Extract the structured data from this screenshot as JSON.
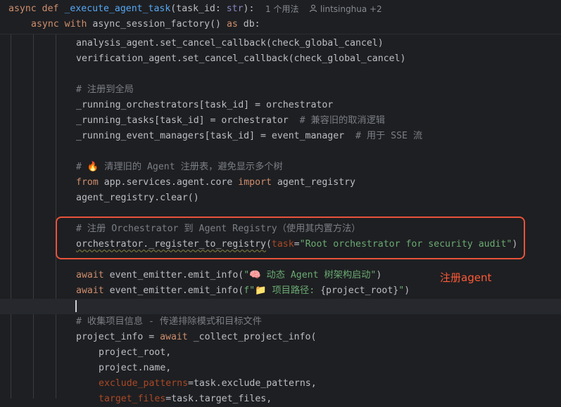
{
  "header": {
    "kw_async": "async",
    "kw_def": "def",
    "func_name": "_execute_agent_task",
    "sig_open": "(",
    "param_name": "task_id",
    "sig_colon": ": ",
    "param_type": "str",
    "sig_close": "):",
    "usage_hint": "1 个用法",
    "author_hint": "lintsinghua +2",
    "line2_kw_async": "async",
    "line2_kw_with": "with",
    "line2_call": "async_session_factory()",
    "line2_kw_as": "as",
    "line2_rest": "db:"
  },
  "code": {
    "l3": "analysis_agent.set_cancel_callback(check_global_cancel)",
    "l4": "verification_agent.set_cancel_callback(check_global_cancel)",
    "l6_comment": "# 注册到全局",
    "l7": "_running_orchestrators[task_id] = orchestrator",
    "l8_code": "_running_tasks[task_id] = orchestrator  ",
    "l8_comment": "# 兼容旧的取消逻辑",
    "l9_code": "_running_event_managers[task_id] = event_manager  ",
    "l9_comment": "# 用于 SSE 流",
    "l11_comment_a": "# ",
    "l11_emoji": "🔥",
    "l11_comment_b": " 清理旧的 Agent 注册表，避免显示多个树",
    "l12_from": "from",
    "l12_mod": " app.services.agent.core ",
    "l12_import": "import",
    "l12_name": " agent_registry",
    "l13": "agent_registry.clear()",
    "l15_comment": "# 注册 Orchestrator 到 Agent Registry（使用其内置方法）",
    "l16_call": "orchestrator._register_to_registry",
    "l16_open": "(",
    "l16_kwarg": "task",
    "l16_eq": "=",
    "l16_str": "\"Root orchestrator for security audit\"",
    "l16_close": ")",
    "l18_await": "await",
    "l18_call": " event_emitter.emit_info(",
    "l18_str_a": "\"",
    "l18_emoji": "🧠",
    "l18_str_b": " 动态 Agent 树架构启动\"",
    "l18_close": ")",
    "l19_await": "await",
    "l19_call": " event_emitter.emit_info(",
    "l19_str_a": "f\"",
    "l19_emoji": "📁",
    "l19_str_b": " 项目路径: ",
    "l19_interp": "{project_root}",
    "l19_str_c": "\"",
    "l19_close": ")",
    "l21_comment": "# 收集项目信息 - 传递排除模式和目标文件",
    "l22_code": "project_info = ",
    "l22_await": "await",
    "l22_rest": " _collect_project_info(",
    "l23": "project_root,",
    "l24": "project.name,",
    "l25_kwarg": "exclude_patterns",
    "l25_rest": "=task.exclude_patterns,",
    "l26_kwarg": "target_files",
    "l26_rest": "=task.target_files,"
  },
  "annotation": {
    "label": "注册agent",
    "color": "#ff5a36"
  },
  "icons": [
    "user-icon"
  ]
}
